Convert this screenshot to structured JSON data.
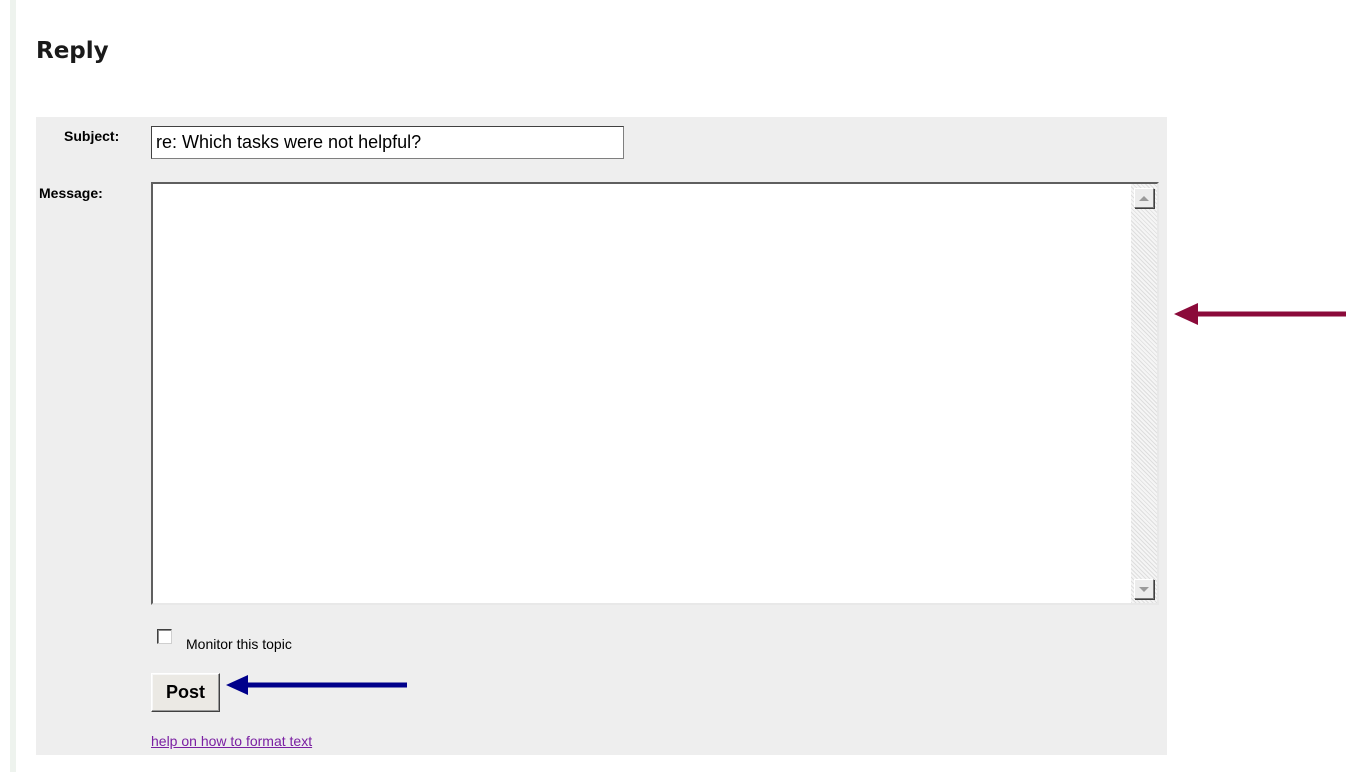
{
  "page": {
    "title": "Reply"
  },
  "form": {
    "subject_label": "Subject:",
    "subject_value": "re: Which tasks were not helpful?",
    "message_label": "Message:",
    "message_value": "",
    "monitor_label": "Monitor this topic",
    "monitor_checked": false,
    "post_label": "Post",
    "help_link": "help on how to format text"
  },
  "colors": {
    "panel_bg": "#eeeeee",
    "link": "#7a1fa2",
    "annotation_arrow_scrollbar": "#8b0a3a",
    "annotation_arrow_post": "#00008b"
  },
  "icons": {
    "scroll_up": "triangle-up",
    "scroll_down": "triangle-down",
    "annotation_1": "arrow-left",
    "annotation_2": "arrow-left"
  }
}
